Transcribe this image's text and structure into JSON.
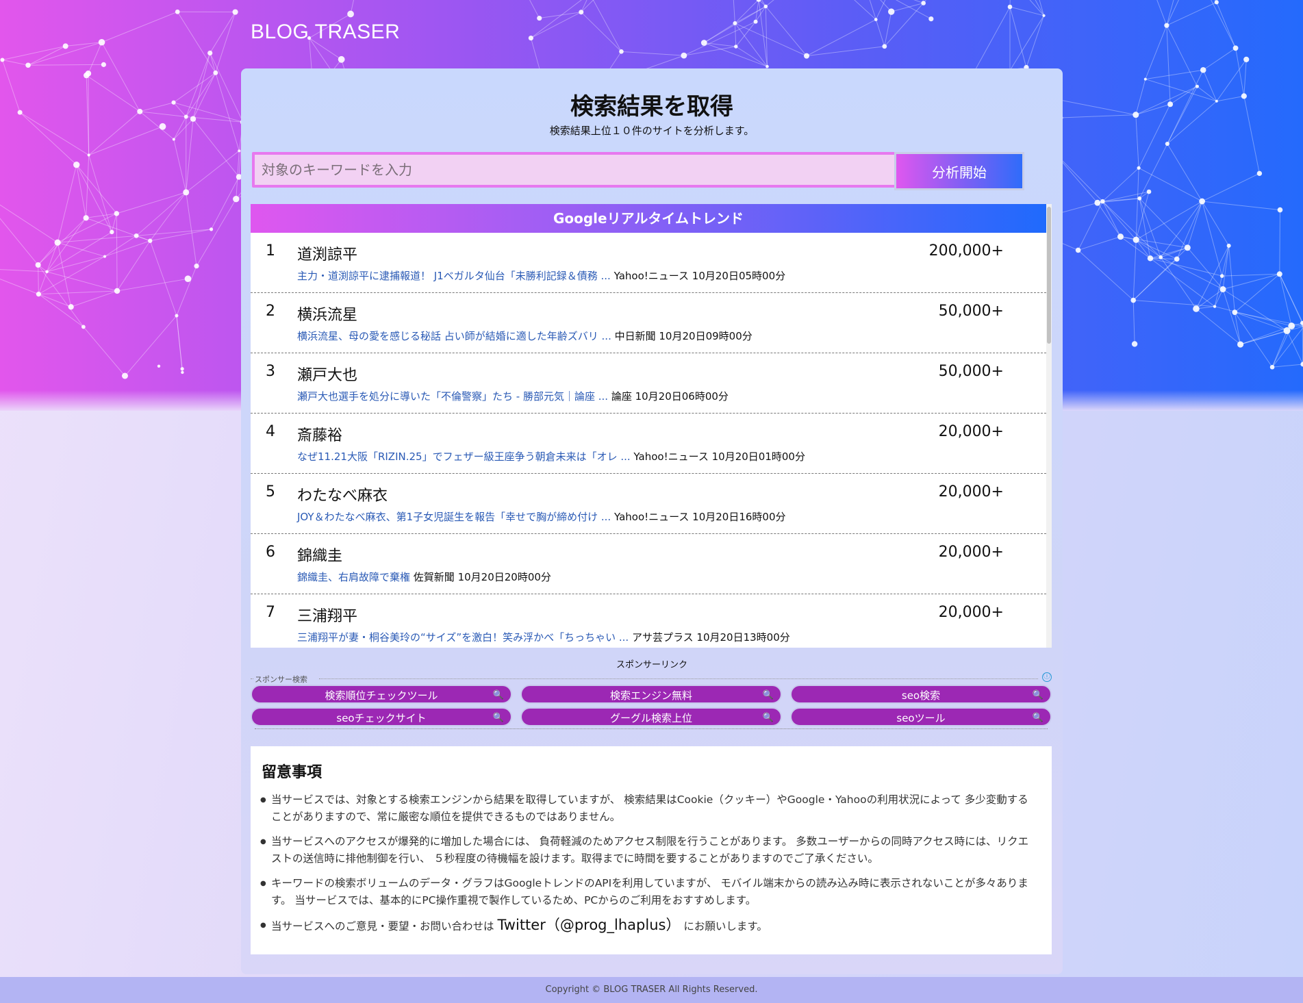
{
  "header": {
    "site_title": "BLOG TRASER"
  },
  "main": {
    "title": "検索結果を取得",
    "subtitle": "検索結果上位１０件のサイトを分析します。",
    "search": {
      "placeholder": "対象のキーワードを入力",
      "value": ""
    },
    "analyze_button": "分析開始"
  },
  "trends": {
    "header": "Googleリアルタイムトレンド",
    "items": [
      {
        "rank": "1",
        "word": "道渕諒平",
        "count": "200,000+",
        "link": "主力・道渕諒平に逮捕報道！ J1ベガルタ仙台「未勝利記録＆債務 ...",
        "source": "Yahoo!ニュース 10月20日05時00分"
      },
      {
        "rank": "2",
        "word": "横浜流星",
        "count": "50,000+",
        "link": "横浜流星、母の愛を感じる秘話 占い師が結婚に適した年齢ズバリ ...",
        "source": "中日新聞 10月20日09時00分"
      },
      {
        "rank": "3",
        "word": "瀬戸大也",
        "count": "50,000+",
        "link": "瀬戸大也選手を処分に導いた「不倫警察」たち - 勝部元気｜論座 ...",
        "source": "論座 10月20日06時00分"
      },
      {
        "rank": "4",
        "word": "斎藤裕",
        "count": "20,000+",
        "link": "なぜ11.21大阪「RIZIN.25」でフェザー級王座争う朝倉未来は「オレ ...",
        "source": "Yahoo!ニュース 10月20日01時00分"
      },
      {
        "rank": "5",
        "word": "わたなべ麻衣",
        "count": "20,000+",
        "link": "JOY＆わたなべ麻衣、第1子女児誕生を報告「幸せで胸が締め付け ...",
        "source": "Yahoo!ニュース 10月20日16時00分"
      },
      {
        "rank": "6",
        "word": "錦織圭",
        "count": "20,000+",
        "link": "錦織圭、右肩故障で棄権",
        "source": "佐賀新聞 10月20日20時00分"
      },
      {
        "rank": "7",
        "word": "三浦翔平",
        "count": "20,000+",
        "link": "三浦翔平が妻・桐谷美玲の“サイズ”を激白！笑み浮かべ「ちっちゃい ...",
        "source": "アサ芸プラス 10月20日13時00分"
      }
    ]
  },
  "sponsor": {
    "label": "スポンサーリンク",
    "search_label": "スポンサー検索",
    "adchoice": "ⓘ",
    "search_glyph": "🔍",
    "buttons": [
      "検索順位チェックツール",
      "検索エンジン無料",
      "seo検索",
      "seoチェックサイト",
      "グーグル検索上位",
      "seoツール"
    ]
  },
  "notes": {
    "title": "留意事項",
    "items": [
      "当サービスでは、対象とする検索エンジンから結果を取得していますが、 検索結果はCookie（クッキー）やGoogle・Yahooの利用状況によって 多少変動することがありますので、常に厳密な順位を提供できるものではありません。",
      "当サービスへのアクセスが爆発的に増加した場合には、 負荷軽減のためアクセス制限を行うことがあります。 多数ユーザーからの同時アクセス時には、リクエストの送信時に排他制御を行い、 ５秒程度の待機幅を設けます。取得までに時間を要することがありますのでご了承ください。",
      "キーワードの検索ボリュームのデータ・グラフはGoogleトレンドのAPIを利用していますが、 モバイル端末からの読み込み時に表示されないことが多々あります。 当サービスでは、基本的にPC操作重視で製作しているため、PCからのご利用をおすすめします。"
    ],
    "contact_prefix": "当サービスへのご意見・要望・お問い合わせは",
    "contact_handle": "Twitter（@prog_lhaplus）",
    "contact_suffix": "にお願いします。"
  },
  "footer": {
    "copyright": "Copyright © BLOG TRASER All Rights Reserved."
  },
  "colors": {
    "hero_left": "#e256ec",
    "hero_right": "#246afc",
    "link": "#2a5ab5",
    "sponsor_button": "#9c28b4",
    "input_bg": "#f2d1f3",
    "input_border": "#e779ef"
  }
}
